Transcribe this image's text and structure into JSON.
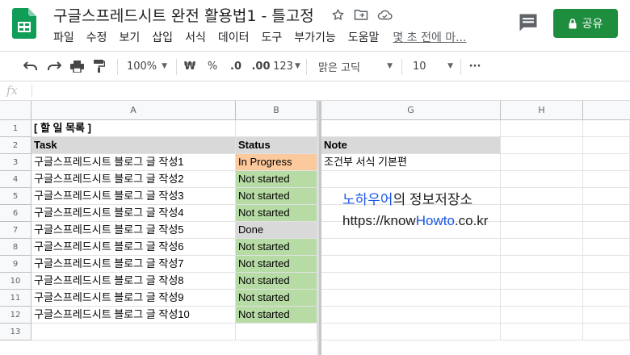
{
  "doc": {
    "title": "구글스프레드시트 완전 활용법1 - 틀고정",
    "share_label": "공유",
    "last_edit": "몇 초 전에 마..."
  },
  "menu": [
    "파일",
    "수정",
    "보기",
    "삽입",
    "서식",
    "데이터",
    "도구",
    "부가기능",
    "도움말"
  ],
  "toolbar": {
    "zoom": "100%",
    "currency": "₩",
    "percent": "%",
    "dec_less": ".0",
    "dec_more": ".00",
    "format_more": "123",
    "font": "맑은 고딕",
    "font_size": "10",
    "more": "···"
  },
  "formula_bar": {
    "fx": "fx",
    "value": ""
  },
  "columns": [
    "A",
    "B",
    "G",
    "H"
  ],
  "rows": [
    "1",
    "2",
    "3",
    "4",
    "5",
    "6",
    "7",
    "8",
    "9",
    "10",
    "11",
    "12",
    "13"
  ],
  "sheet": {
    "title_cell": "[ 할 일 목록 ]",
    "headers": {
      "task": "Task",
      "status": "Status",
      "note": "Note"
    },
    "tasks": [
      {
        "task": "구글스프레드시트 블로그 글 작성1",
        "status": "In Progress",
        "status_color": "#fcc99c"
      },
      {
        "task": "구글스프레드시트 블로그 글 작성2",
        "status": "Not started",
        "status_color": "#b7dba4"
      },
      {
        "task": "구글스프레드시트 블로그 글 작성3",
        "status": "Not started",
        "status_color": "#b7dba4"
      },
      {
        "task": "구글스프레드시트 블로그 글 작성4",
        "status": "Not started",
        "status_color": "#b7dba4"
      },
      {
        "task": "구글스프레드시트 블로그 글 작성5",
        "status": "Done",
        "status_color": "#d9d9d9"
      },
      {
        "task": "구글스프레드시트 블로그 글 작성6",
        "status": "Not started",
        "status_color": "#b7dba4"
      },
      {
        "task": "구글스프레드시트 블로그 글 작성7",
        "status": "Not started",
        "status_color": "#b7dba4"
      },
      {
        "task": "구글스프레드시트 블로그 글 작성8",
        "status": "Not started",
        "status_color": "#b7dba4"
      },
      {
        "task": "구글스프레드시트 블로그 글 작성9",
        "status": "Not started",
        "status_color": "#b7dba4"
      },
      {
        "task": "구글스프레드시트 블로그 글 작성10",
        "status": "Not started",
        "status_color": "#b7dba4"
      }
    ],
    "note_first": "조건부 서식 기본편"
  },
  "overlay": {
    "line1_blue": "노하우어",
    "line1_rest": "의 정보저장소",
    "url_a": "https://know",
    "url_b": "Howto",
    "url_c": ".co.kr"
  },
  "colors": {
    "header_fill": "#d9d9d9",
    "share_green": "#1e8e3e",
    "brand_blue": "#1a56e8"
  }
}
